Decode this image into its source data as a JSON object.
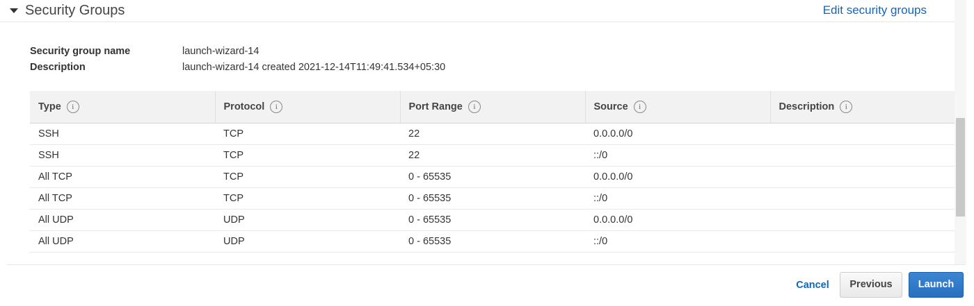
{
  "section": {
    "title": "Security Groups",
    "edit_link": "Edit security groups"
  },
  "details": {
    "name_label": "Security group name",
    "name_value": "launch-wizard-14",
    "description_label": "Description",
    "description_value": "launch-wizard-14 created 2021-12-14T11:49:41.534+05:30"
  },
  "table": {
    "columns": [
      "Type",
      "Protocol",
      "Port Range",
      "Source",
      "Description"
    ],
    "rows": [
      [
        "SSH",
        "TCP",
        "22",
        "0.0.0.0/0",
        ""
      ],
      [
        "SSH",
        "TCP",
        "22",
        "::/0",
        ""
      ],
      [
        "All TCP",
        "TCP",
        "0 - 65535",
        "0.0.0.0/0",
        ""
      ],
      [
        "All TCP",
        "TCP",
        "0 - 65535",
        "::/0",
        ""
      ],
      [
        "All UDP",
        "UDP",
        "0 - 65535",
        "0.0.0.0/0",
        ""
      ],
      [
        "All UDP",
        "UDP",
        "0 - 65535",
        "::/0",
        ""
      ]
    ]
  },
  "icons": {
    "info": "i"
  },
  "footer": {
    "cancel": "Cancel",
    "previous": "Previous",
    "launch": "Launch"
  },
  "colors": {
    "link": "#1166bb",
    "primary_button": "#2770bf",
    "header_bg": "#f2f2f2"
  }
}
